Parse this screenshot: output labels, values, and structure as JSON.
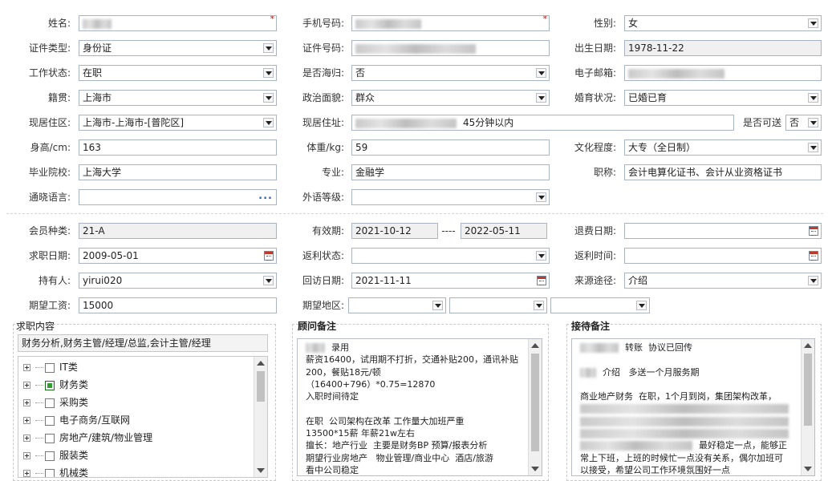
{
  "form": {
    "name": {
      "label": "姓名:",
      "value": ""
    },
    "phone": {
      "label": "手机号码:",
      "value": ""
    },
    "gender": {
      "label": "性别:",
      "value": "女"
    },
    "id_type": {
      "label": "证件类型:",
      "value": "身份证"
    },
    "id_no": {
      "label": "证件号码:",
      "value": ""
    },
    "birth": {
      "label": "出生日期:",
      "value": "1978-11-22"
    },
    "work_status": {
      "label": "工作状态:",
      "value": "在职"
    },
    "returnee": {
      "label": "是否海归:",
      "value": "否"
    },
    "email": {
      "label": "电子邮箱:",
      "value": ""
    },
    "native": {
      "label": "籍贯:",
      "value": "上海市"
    },
    "political": {
      "label": "政治面貌:",
      "value": "群众"
    },
    "marital": {
      "label": "婚育状况:",
      "value": "已婚已育"
    },
    "residence": {
      "label": "现居住区:",
      "value": "上海市-上海市-[普陀区]"
    },
    "address": {
      "label": "现居住址:",
      "value": "45分钟以内"
    },
    "can_send": {
      "label": "是否可送",
      "value": "否"
    },
    "height": {
      "label": "身高/cm:",
      "value": "163"
    },
    "weight": {
      "label": "体重/kg:",
      "value": "59"
    },
    "education": {
      "label": "文化程度:",
      "value": "大专（全日制）"
    },
    "school": {
      "label": "毕业院校:",
      "value": "上海大学"
    },
    "major": {
      "label": "专业:",
      "value": "金融学"
    },
    "title": {
      "label": "职称:",
      "value": "会计电算化证书、会计从业资格证书"
    },
    "language": {
      "label": "通晓语言:",
      "value": "",
      "button": "..."
    },
    "foreign_level": {
      "label": "外语等级:",
      "value": ""
    }
  },
  "member": {
    "type": {
      "label": "会员种类:",
      "value": "21-A"
    },
    "validity": {
      "label": "有效期:",
      "from": "2021-10-12",
      "sep": "----",
      "to": "2022-05-11"
    },
    "refund_date": {
      "label": "退费日期:",
      "value": ""
    },
    "job_date": {
      "label": "求职日期:",
      "value": "2009-05-01"
    },
    "rebate_status": {
      "label": "返利状态:",
      "value": ""
    },
    "rebate_time": {
      "label": "返利时间:",
      "value": ""
    },
    "holder": {
      "label": "持有人:",
      "value": "yirui020"
    },
    "revisit_date": {
      "label": "回访日期:",
      "value": "2021-11-11"
    },
    "source": {
      "label": "来源途径:",
      "value": "介绍"
    },
    "salary": {
      "label": "期望工资:",
      "value": "15000"
    },
    "area": {
      "label": "期望地区:",
      "values": [
        "",
        "",
        ""
      ]
    }
  },
  "job": {
    "title": "求职内容",
    "summary": "财务分析,财务主管/经理/总监,会计主管/经理",
    "categories": [
      {
        "label": "IT类",
        "checked": false
      },
      {
        "label": "财务类",
        "checked": true
      },
      {
        "label": "采购类",
        "checked": false
      },
      {
        "label": "电子商务/互联网",
        "checked": false
      },
      {
        "label": "房地产/建筑/物业管理",
        "checked": false
      },
      {
        "label": "服装类",
        "checked": false
      },
      {
        "label": "机械类",
        "checked": false
      }
    ]
  },
  "consultant": {
    "title": "顾问备注",
    "lines": [
      "录用",
      "薪资16400，试用期不打折，交通补贴200，通讯补贴",
      "200，餐贴18元/顿",
      "（16400+796）*0.75=12870",
      "入职时间待定",
      "",
      "在职  公司架构在改革 工作量大加班严重",
      "13500*15薪 年薪21w左右",
      "擅长：地产行业  主要是财务BP 预算/报表分析",
      "期望行业房地产   物业管理/商业中心  酒店/旅游",
      "看中公司稳定"
    ]
  },
  "reception": {
    "title": "接待备注",
    "lines": [
      "转账  协议已回传",
      "",
      "介绍   多送一个月服务期",
      "",
      "商业地产财务  在职，1个月到岗，集团架构改革，",
      "",
      "",
      "",
      "最好稳定一点，能够正",
      "常上下班，上班的时候忙一点没有关系，偶尔加班可",
      "以接受，希望公司工作环境氛围好一点"
    ]
  },
  "colors": {
    "border": "#a9b4c2",
    "required": "#e00000",
    "readonly": "#f0f0f0",
    "checked": "#2fa02f"
  }
}
